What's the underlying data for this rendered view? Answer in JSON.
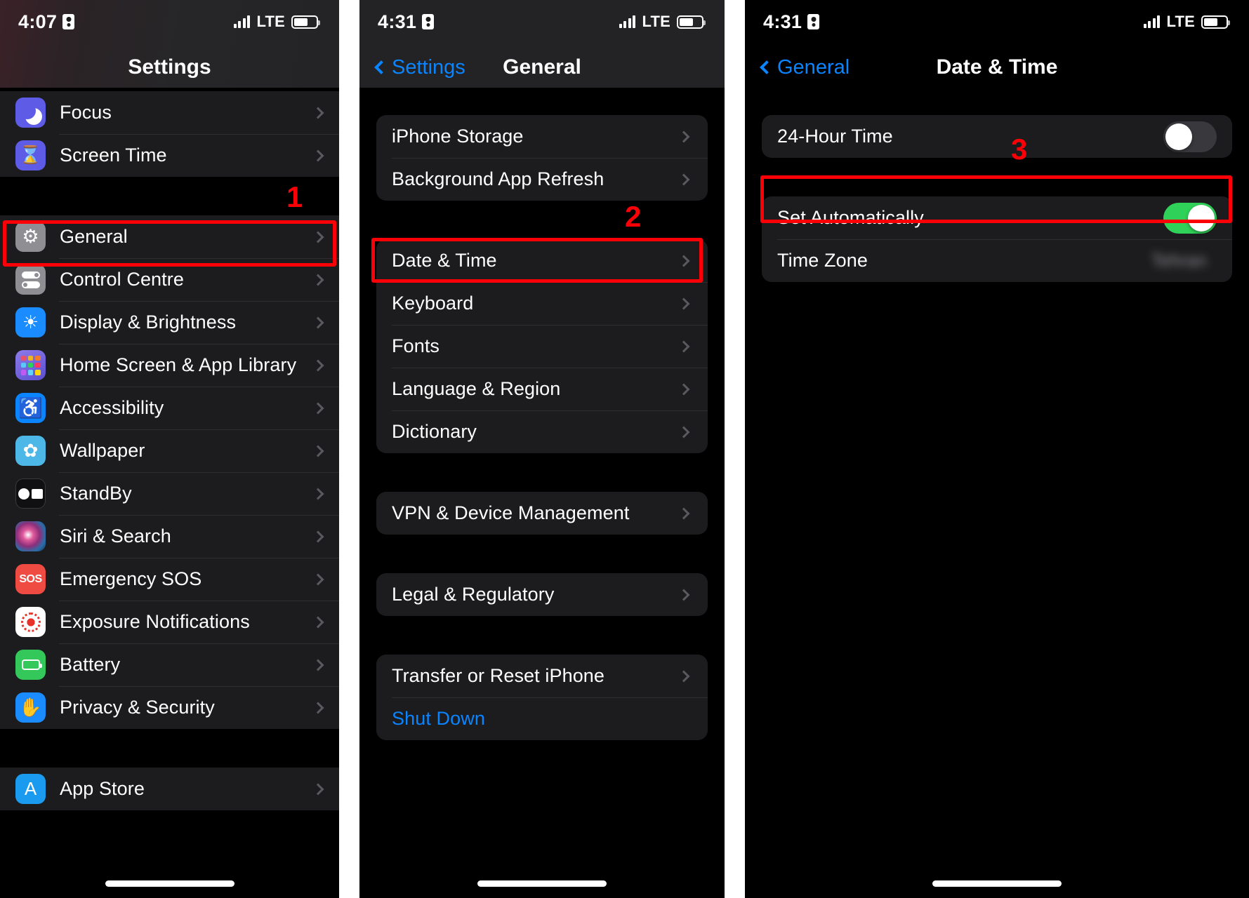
{
  "panels": [
    {
      "id": "settings",
      "statusbar": {
        "time": "4:07",
        "carrier": "LTE",
        "lock_icon": "lock-portrait-icon"
      },
      "nav": {
        "title": "Settings",
        "back": null
      },
      "groups": [
        {
          "rows": [
            {
              "label": "Focus",
              "icon": "moon-icon",
              "icon_bg": "#5e5ce6",
              "chevron": true
            },
            {
              "label": "Screen Time",
              "icon": "hourglass-icon",
              "icon_bg": "#5e5ce6",
              "chevron": true
            }
          ]
        },
        {
          "rows": [
            {
              "label": "General",
              "icon": "gear-icon",
              "icon_bg": "#8e8e93",
              "chevron": true
            },
            {
              "label": "Control Centre",
              "icon": "control-centre-icon",
              "icon_bg": "#8e8e93",
              "chevron": true
            },
            {
              "label": "Display & Brightness",
              "icon": "brightness-sun-icon",
              "icon_bg": "#1a8cff",
              "chevron": true
            },
            {
              "label": "Home Screen & App Library",
              "icon": "home-screen-grid-icon",
              "icon_bg": "#6a5bd4",
              "chevron": true
            },
            {
              "label": "Accessibility",
              "icon": "accessibility-icon",
              "icon_bg": "#0a84ff",
              "chevron": true
            },
            {
              "label": "Wallpaper",
              "icon": "wallpaper-flower-icon",
              "icon_bg": "#4db8e8",
              "chevron": true
            },
            {
              "label": "StandBy",
              "icon": "standby-clock-icon",
              "icon_bg": "#1c1c1e",
              "chevron": true
            },
            {
              "label": "Siri & Search",
              "icon": "siri-orb-icon",
              "icon_bg": "#2a2a4a",
              "chevron": true
            },
            {
              "label": "Emergency SOS",
              "icon": "sos-icon",
              "icon_bg": "#ef4b43",
              "chevron": true
            },
            {
              "label": "Exposure Notifications",
              "icon": "exposure-notifications-icon",
              "icon_bg": "#ffffff",
              "chevron": true
            },
            {
              "label": "Battery",
              "icon": "battery-icon",
              "icon_bg": "#34c759",
              "chevron": true
            },
            {
              "label": "Privacy & Security",
              "icon": "hand-privacy-icon",
              "icon_bg": "#1a8cff",
              "chevron": true
            }
          ]
        },
        {
          "rows": [
            {
              "label": "App Store",
              "icon": "app-store-icon",
              "icon_bg": "#1a9bf0",
              "chevron": true
            }
          ]
        }
      ],
      "annotation": {
        "number": "1",
        "target": "General"
      }
    },
    {
      "id": "general",
      "statusbar": {
        "time": "4:31",
        "carrier": "LTE",
        "lock_icon": "lock-portrait-icon"
      },
      "nav": {
        "title": "General",
        "back": "Settings"
      },
      "cards": [
        {
          "rows": [
            {
              "label": "iPhone Storage",
              "chevron": true
            },
            {
              "label": "Background App Refresh",
              "chevron": true
            }
          ]
        },
        {
          "rows": [
            {
              "label": "Date & Time",
              "chevron": true
            },
            {
              "label": "Keyboard",
              "chevron": true
            },
            {
              "label": "Fonts",
              "chevron": true
            },
            {
              "label": "Language & Region",
              "chevron": true
            },
            {
              "label": "Dictionary",
              "chevron": true
            }
          ]
        },
        {
          "rows": [
            {
              "label": "VPN & Device Management",
              "chevron": true
            }
          ]
        },
        {
          "rows": [
            {
              "label": "Legal & Regulatory",
              "chevron": true
            }
          ]
        },
        {
          "rows": [
            {
              "label": "Transfer or Reset iPhone",
              "chevron": true
            },
            {
              "label": "Shut Down",
              "chevron": false,
              "link": true
            }
          ]
        }
      ],
      "annotation": {
        "number": "2",
        "target": "Date & Time"
      }
    },
    {
      "id": "date-time",
      "statusbar": {
        "time": "4:31",
        "carrier": "LTE",
        "lock_icon": "lock-portrait-icon"
      },
      "nav": {
        "title": "Date & Time",
        "back": "General"
      },
      "cards": [
        {
          "rows": [
            {
              "label": "24-Hour Time",
              "toggle": "off"
            }
          ]
        },
        {
          "rows": [
            {
              "label": "Set Automatically",
              "toggle": "on"
            },
            {
              "label": "Time Zone",
              "value": "Tehran",
              "value_blurred": true
            }
          ]
        }
      ],
      "annotation": {
        "number": "3",
        "target": "Set Automatically"
      }
    }
  ],
  "colors": {
    "accent_blue": "#0a84ff",
    "toggle_on_green": "#30d158",
    "annotation_red": "#fb0007",
    "card_bg": "#1c1c1e",
    "page_bg": "#000000"
  }
}
